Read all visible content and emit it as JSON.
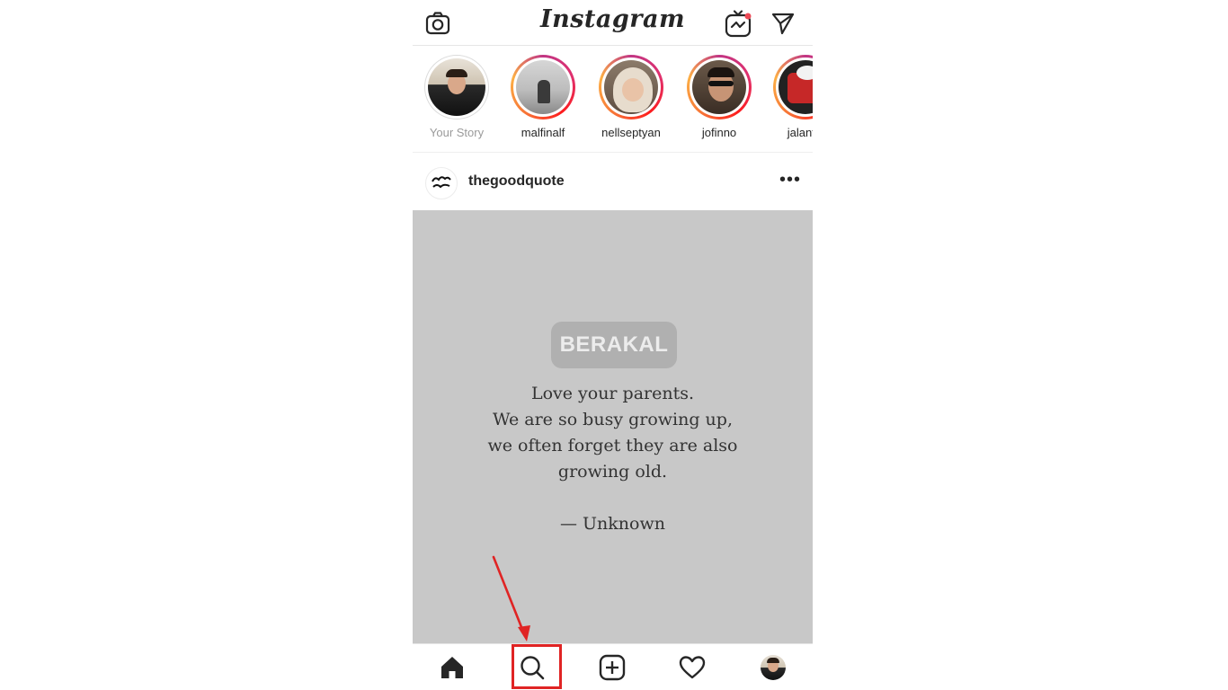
{
  "app": {
    "title": "Instagram"
  },
  "stories": [
    {
      "label": "Your Story",
      "own": true
    },
    {
      "label": "malfinalf"
    },
    {
      "label": "nellseptyan"
    },
    {
      "label": "jofinno"
    },
    {
      "label": "jalantik"
    }
  ],
  "post": {
    "username": "thegoodquote",
    "more_label": "•••",
    "watermark": "BERAKAL",
    "quote_lines": [
      "Love your parents.",
      "We are so busy growing up,",
      "we often forget they are also",
      "growing old."
    ],
    "author": "— Unknown"
  },
  "nav": {
    "items": [
      "home",
      "search",
      "new-post",
      "activity",
      "profile"
    ],
    "highlighted": "search"
  },
  "colors": {
    "highlight": "#e02424",
    "post_background": "#c8c8c8",
    "text": "#262626"
  }
}
